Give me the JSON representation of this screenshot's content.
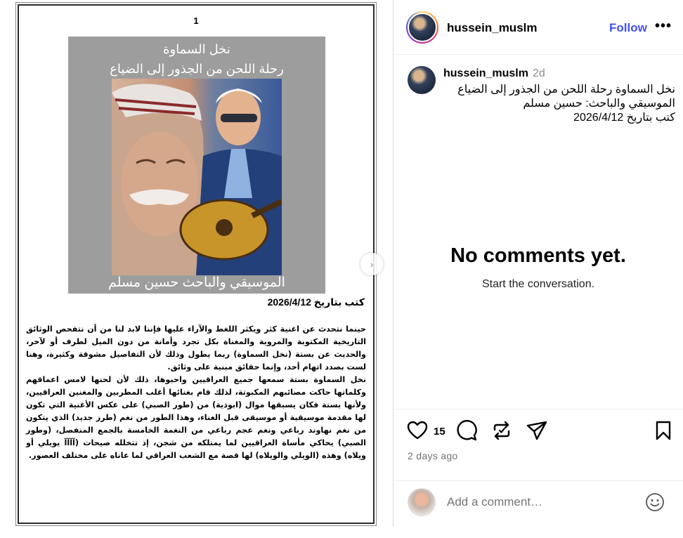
{
  "document": {
    "page_number": "1",
    "cover_title_1": "نخل السماوة",
    "cover_title_2": "رحلة اللحن من الجذور إلى الضياع",
    "cover_footer": "الموسيقي والباحث حسين مسلم",
    "date_line": "كتب بتاريخ 2026/4/12",
    "paragraphs": [
      "حينما نتحدث عن اغنية كثر ويكثر اللغط والآراء عليها فإننا لابد لنا من أن نتفحص الوثائق التاريخية المكتوبة والمروية والمغناة بكل تجرد وأمانة من دون الميل لطرف أو لآخر، والحديث عن بستة (نخل السماوة) ربما يطول وذلك لأن التفاصيل مشوقة وكثيرة، وهنا لست بصدد اتهام أحد، وإنما حقائق مبنية على وثائق.",
      "نخل السماوة بستة سمعها جميع العراقيين واحبوها، ذلك لأن لحنها لامس اعماقهم وكلماتها حاكت مصائبهم المكبوتة، لذلك قام بغنائها أغلب المطربين والمغنين العراقيين، ولأنها بستة فكان يسبقها موال (ابوذية) من (طور الصبي) على عكس الأغنية التي تكون لها مقدمة موسيقية أو موسيقى قبل الغناء، وهذا الطور من نغم (طرز جديد) الذي يتكون من نغم نهاوند رباعي ونغم عجم رباعي من النغمة الخامسة بالجمع المنفصل، (وطور الصبي) يحاكي مأساة العراقيين لما يمتلكه من شجن، إذ تتخلله صيحات (آآآآ يويلي أو ويلاه) وهذه (الويلي والويلاه) لها قصة مع الشعب العراقي لما عاناه على مختلف العصور."
    ]
  },
  "header": {
    "username": "hussein_muslm",
    "follow_label": "Follow",
    "more_label": "•••"
  },
  "caption": {
    "username": "hussein_muslm",
    "time": "2d",
    "lines": [
      "نخل السماوة رحلة اللحن من الجذور إلى الضياع",
      "الموسيقي والباحث: حسين مسلم",
      "كتب بتاريخ 2026/4/12"
    ]
  },
  "comments": {
    "empty_title": "No comments yet.",
    "empty_subtitle": "Start the conversation."
  },
  "actions": {
    "like_count": "15",
    "posted_ago": "2 days ago",
    "icons": [
      "heart-icon",
      "comment-icon",
      "repost-icon",
      "share-icon",
      "bookmark-icon"
    ]
  },
  "add_comment": {
    "placeholder": "Add a comment…"
  },
  "colors": {
    "follow": "#4150f7",
    "muted": "#737373",
    "divider": "#efefef"
  }
}
